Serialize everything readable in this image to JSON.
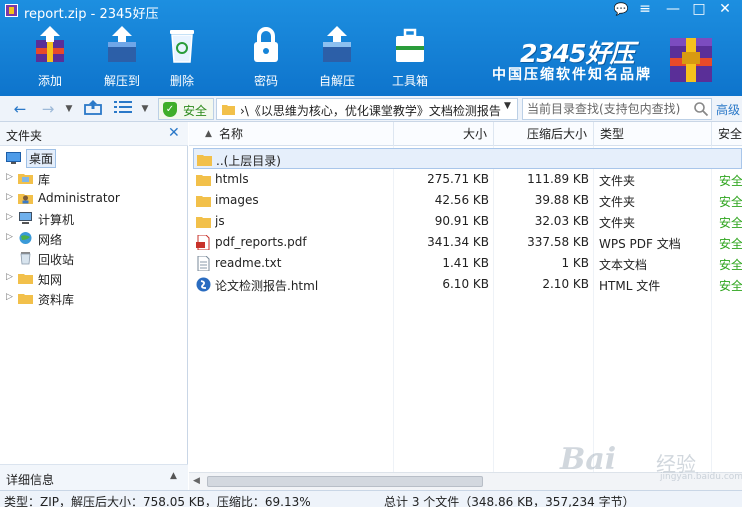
{
  "window": {
    "title": "report.zip - 2345好压",
    "controls": {
      "feedback": "💬",
      "menu": "≡",
      "minimize": "—",
      "maximize": "□",
      "close": "✕"
    }
  },
  "toolbar": {
    "add": "添加",
    "extract": "解压到",
    "delete": "删除",
    "password": "密码",
    "sfx": "自解压",
    "toolbox": "工具箱"
  },
  "brand": {
    "logo": "2345好压",
    "slogan": "中国压缩软件知名品牌"
  },
  "nav": {
    "safe_label": "安全",
    "address": "›\\《以思维为核心，优化课堂教学》文档检测报告",
    "search_placeholder": "当前目录查找(支持包内查找)",
    "advanced": "高级"
  },
  "left_panel": {
    "title": "文件夹",
    "items": [
      {
        "label": "桌面"
      },
      {
        "label": "库"
      },
      {
        "label": "Administrator"
      },
      {
        "label": "计算机"
      },
      {
        "label": "网络"
      },
      {
        "label": "回收站"
      },
      {
        "label": "知网"
      },
      {
        "label": "资料库"
      }
    ],
    "details_label": "详细信息"
  },
  "columns": {
    "name": "名称",
    "size": "大小",
    "compressed": "压缩后大小",
    "type": "类型",
    "safety": "安全"
  },
  "files": [
    {
      "name": "..(上层目录)",
      "size": "",
      "compressed": "",
      "type": "",
      "safety": "",
      "icon": "folder-up-icon"
    },
    {
      "name": "htmls",
      "size": "275.71 KB",
      "compressed": "111.89 KB",
      "type": "文件夹",
      "safety": "安全",
      "icon": "folder-icon"
    },
    {
      "name": "images",
      "size": "42.56 KB",
      "compressed": "39.88 KB",
      "type": "文件夹",
      "safety": "安全",
      "icon": "folder-icon"
    },
    {
      "name": "js",
      "size": "90.91 KB",
      "compressed": "32.03 KB",
      "type": "文件夹",
      "safety": "安全",
      "icon": "folder-icon"
    },
    {
      "name": "pdf_reports.pdf",
      "size": "341.34 KB",
      "compressed": "337.58 KB",
      "type": "WPS PDF 文档",
      "safety": "安全",
      "icon": "pdf-icon"
    },
    {
      "name": "readme.txt",
      "size": "1.41 KB",
      "compressed": "1 KB",
      "type": "文本文档",
      "safety": "安全",
      "icon": "text-file-icon"
    },
    {
      "name": "论文检测报告.html",
      "size": "6.10 KB",
      "compressed": "2.10 KB",
      "type": "HTML 文件",
      "safety": "安全",
      "icon": "html-file-icon"
    }
  ],
  "status": {
    "left": "类型：ZIP，解压后大小：758.05 KB，压缩比：69.13%",
    "right": "总计 3 个文件（348.86 KB，357,234 字节）"
  },
  "watermark": {
    "text": "Bai",
    "sub": "经验",
    "url": "jingyan.baidu.com"
  },
  "colors": {
    "top_bar": "#1584d8",
    "folder": "#f2c04a",
    "safe_green": "#2fa51e",
    "accent_blue": "#2a78c8"
  }
}
